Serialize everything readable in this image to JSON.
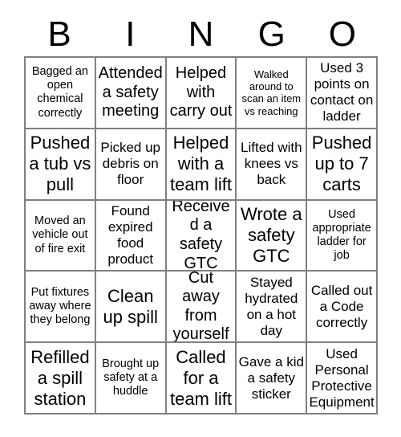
{
  "card": {
    "title_letters": [
      "B",
      "I",
      "N",
      "G",
      "O"
    ],
    "columns": 5,
    "rows": 5,
    "border_color": "#808080",
    "text_color": "#000000",
    "background_color": "#ffffff"
  },
  "cells": [
    {
      "text": "Bagged an open chemical correctly",
      "size": "sm"
    },
    {
      "text": "Attended a safety meeting",
      "size": "lg"
    },
    {
      "text": "Helped with carry out",
      "size": "lg"
    },
    {
      "text": "Walked around to scan an item vs reaching",
      "size": "xs"
    },
    {
      "text": "Used 3 points on contact on ladder",
      "size": "md"
    },
    {
      "text": "Pushed a tub vs pull",
      "size": "xl"
    },
    {
      "text": "Picked up debris on floor",
      "size": "md"
    },
    {
      "text": "Helped with a team lift",
      "size": "xl"
    },
    {
      "text": "Lifted with knees vs back",
      "size": "md"
    },
    {
      "text": "Pushed up to 7 carts",
      "size": "xl"
    },
    {
      "text": "Moved an vehicle out of fire exit",
      "size": "sm"
    },
    {
      "text": "Found expired food product",
      "size": "md"
    },
    {
      "text": "Received a safety GTC",
      "size": "lg"
    },
    {
      "text": "Wrote a safety GTC",
      "size": "xl"
    },
    {
      "text": "Used appropriate ladder for job",
      "size": "sm"
    },
    {
      "text": "Put fixtures away where they belong",
      "size": "sm"
    },
    {
      "text": "Clean up spill",
      "size": "xl"
    },
    {
      "text": "Cut away from yourself",
      "size": "lg"
    },
    {
      "text": "Stayed hydrated on a hot day",
      "size": "md"
    },
    {
      "text": "Called out a Code correctly",
      "size": "md"
    },
    {
      "text": "Refilled a spill station",
      "size": "xl"
    },
    {
      "text": "Brought up safety at a huddle",
      "size": "sm"
    },
    {
      "text": "Called for a team lift",
      "size": "xl"
    },
    {
      "text": "Gave a kid a safety sticker",
      "size": "md"
    },
    {
      "text": "Used Personal Protective Equipment",
      "size": "md"
    }
  ]
}
